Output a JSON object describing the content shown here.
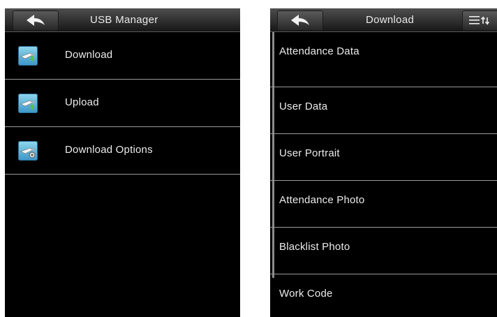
{
  "left_screen": {
    "title": "USB Manager",
    "back_icon": "back-arrow-icon",
    "items": [
      {
        "label": "Download",
        "icon": "usb-download-icon"
      },
      {
        "label": "Upload",
        "icon": "usb-upload-icon"
      },
      {
        "label": "Download Options",
        "icon": "usb-options-icon"
      }
    ]
  },
  "right_screen": {
    "title": "Download",
    "back_icon": "back-arrow-icon",
    "menu_icon": "list-menu-icon",
    "items": [
      {
        "label": "Attendance Data"
      },
      {
        "label": "User Data"
      },
      {
        "label": "User Portrait"
      },
      {
        "label": "Attendance Photo"
      },
      {
        "label": "Blacklist Photo"
      },
      {
        "label": "Work Code"
      }
    ]
  },
  "colors": {
    "screen_bg": "#000000",
    "text": "#ececec",
    "divider": "#9a9a9a",
    "icon_blue": "#3b95c6",
    "icon_green": "#56c23a"
  }
}
